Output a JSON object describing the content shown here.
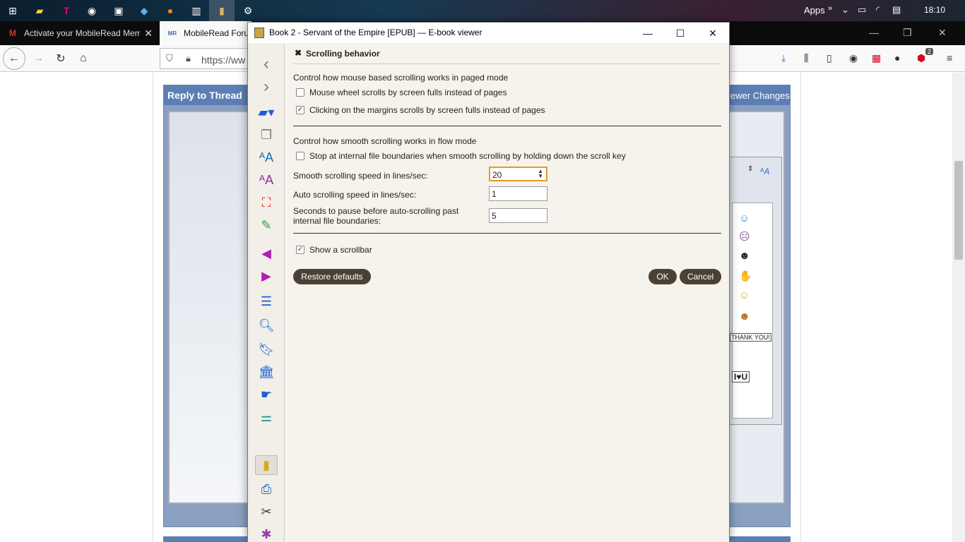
{
  "taskbar": {
    "apps_label": "Apps",
    "clock": "18:10"
  },
  "firefox": {
    "tabs": [
      {
        "label": "Activate your MobileRead Mem",
        "favicon": "M"
      },
      {
        "label": "MobileRead Forum",
        "favicon": "MR"
      }
    ],
    "url": "https://ww",
    "abp_badge": "2"
  },
  "forum": {
    "reply_header": "Reply to Thread",
    "reply_header_right": "ewer Changes",
    "thank_you_sign": "THANK YOU!",
    "i_love_u_sign": "I♥U"
  },
  "viewer": {
    "title": "Book 2 - Servant of the Empire [EPUB] — E-book viewer",
    "dialog": {
      "title": "Scrolling behavior",
      "section1": "Control how mouse based scrolling works in paged mode",
      "cb_mouse_wheel": "Mouse wheel scrolls by screen fulls instead of pages",
      "cb_margins": "Clicking on the margins scrolls by screen fulls instead of pages",
      "section2": "Control how smooth scrolling works in flow mode",
      "cb_stop_internal": "Stop at internal file boundaries when smooth scrolling by holding down the scroll key",
      "smooth_speed_label": "Smooth scrolling speed in lines/sec:",
      "smooth_speed_value": "20",
      "auto_speed_label": "Auto scrolling speed in lines/sec:",
      "auto_speed_value": "1",
      "pause_label_1": "Seconds to pause before auto-scrolling past",
      "pause_label_2": "internal file boundaries:",
      "pause_value": "5",
      "cb_scrollbar": "Show a scrollbar",
      "restore_defaults": "Restore defaults",
      "ok": "OK",
      "cancel": "Cancel",
      "checked": {
        "mouse_wheel": false,
        "margins": true,
        "stop_internal": false,
        "scrollbar": true
      }
    }
  }
}
